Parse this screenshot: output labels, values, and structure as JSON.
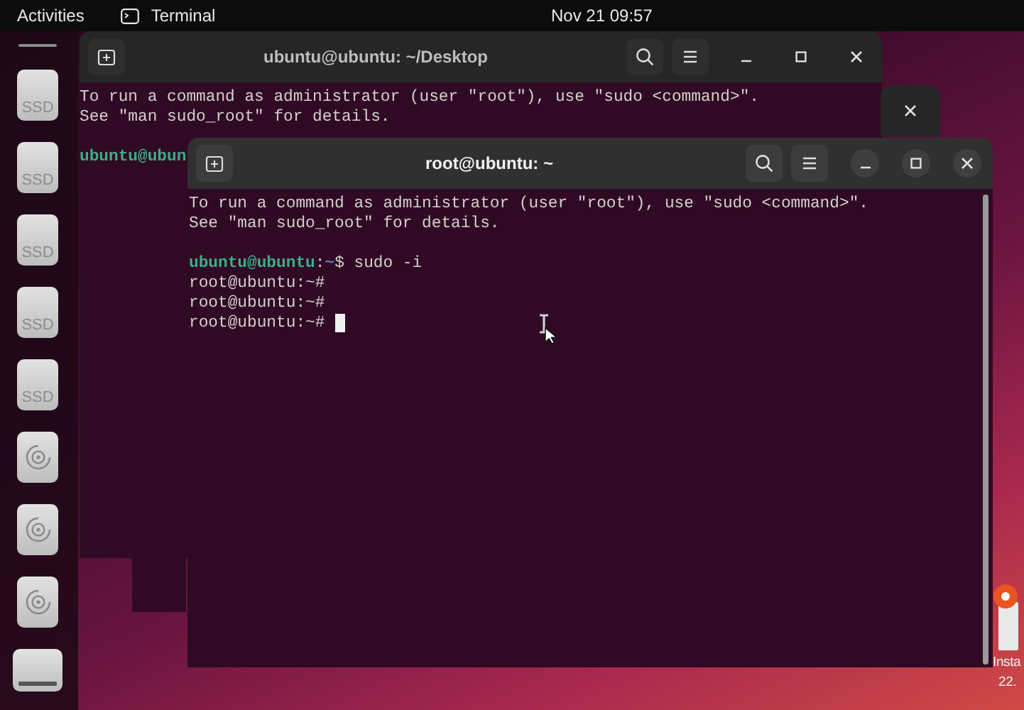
{
  "top_bar": {
    "activities": "Activities",
    "app": "Terminal",
    "clock": "Nov 21  09:57"
  },
  "dock": {
    "items": [
      {
        "kind": "ssd",
        "label": "SSD"
      },
      {
        "kind": "ssd",
        "label": "SSD"
      },
      {
        "kind": "ssd",
        "label": "SSD"
      },
      {
        "kind": "ssd",
        "label": "SSD"
      },
      {
        "kind": "ssd",
        "label": "SSD"
      },
      {
        "kind": "disc"
      },
      {
        "kind": "disc"
      },
      {
        "kind": "disc"
      },
      {
        "kind": "drive"
      }
    ]
  },
  "windows": [
    {
      "kind": "terminal",
      "title": "ubuntu@ubuntu: ~/Desktop",
      "focused": false,
      "lines": [
        {
          "kind": "text",
          "segments": [
            {
              "kind": "plain",
              "text": "To run a command as administrator (user \"root\"), use \"sudo <command>\"."
            }
          ]
        },
        {
          "kind": "text",
          "segments": [
            {
              "kind": "plain",
              "text": "See \"man sudo_root\" for details."
            }
          ]
        },
        {
          "kind": "blank"
        },
        {
          "kind": "text",
          "segments": [
            {
              "kind": "user",
              "text": "ubuntu@ubun"
            }
          ]
        }
      ]
    },
    {
      "kind": "partial",
      "focused": false
    },
    {
      "kind": "terminal",
      "title": "root@ubuntu: ~",
      "focused": true,
      "cursor": true,
      "lines": [
        {
          "kind": "text",
          "segments": [
            {
              "kind": "plain",
              "text": "To run a command as administrator (user \"root\"), use \"sudo <command>\"."
            }
          ]
        },
        {
          "kind": "text",
          "segments": [
            {
              "kind": "plain",
              "text": "See \"man sudo_root\" for details."
            }
          ]
        },
        {
          "kind": "blank"
        },
        {
          "kind": "text",
          "segments": [
            {
              "kind": "user",
              "text": "ubuntu@ubuntu"
            },
            {
              "kind": "plain",
              "text": ":"
            },
            {
              "kind": "path",
              "text": "~"
            },
            {
              "kind": "plain",
              "text": "$ sudo -i"
            }
          ]
        },
        {
          "kind": "text",
          "segments": [
            {
              "kind": "plain",
              "text": "root@ubuntu:~#"
            }
          ]
        },
        {
          "kind": "text",
          "segments": [
            {
              "kind": "plain",
              "text": "root@ubuntu:~#"
            }
          ]
        },
        {
          "kind": "text",
          "segments": [
            {
              "kind": "plain",
              "text": "root@ubuntu:~# "
            }
          ]
        }
      ]
    }
  ],
  "desktop_icons": [
    {
      "label": "Insta",
      "sublabel": "22."
    }
  ]
}
